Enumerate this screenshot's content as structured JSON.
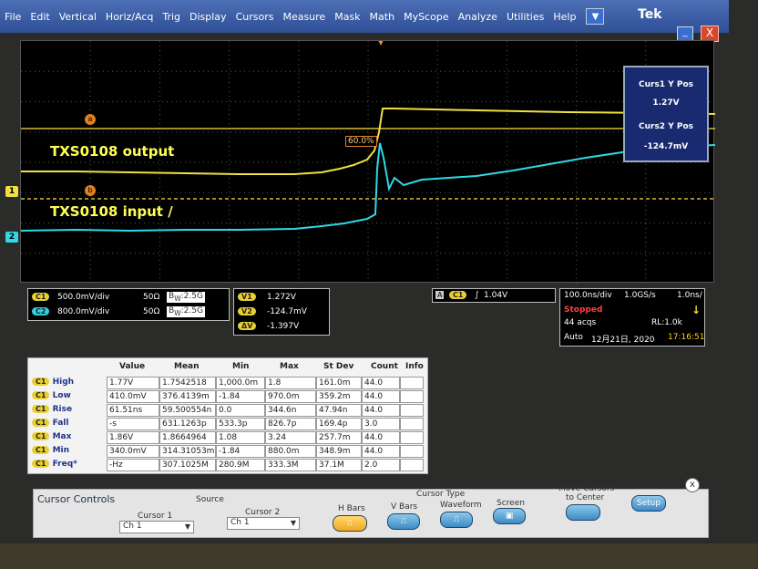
{
  "menu": [
    "File",
    "Edit",
    "Vertical",
    "Horiz/Acq",
    "Trig",
    "Display",
    "Cursors",
    "Measure",
    "Mask",
    "Math",
    "MyScope",
    "Analyze",
    "Utilities",
    "Help"
  ],
  "brand": "Tek",
  "window": {
    "minimize": "_",
    "close": "X",
    "dropdown": "▼"
  },
  "annotations": {
    "output": "TXS0108 output",
    "input": "TXS0108 input /"
  },
  "cursor_markers": {
    "a": "a",
    "b": "b",
    "percent": "60.0%"
  },
  "channel_markers": {
    "ch1": "1",
    "ch2": "2"
  },
  "cursor_readout": {
    "curs1_label": "Curs1 Y Pos",
    "curs1_value": "1.27V",
    "curs2_label": "Curs2 Y Pos",
    "curs2_value": "-124.7mV"
  },
  "channels": [
    {
      "chip": "C1",
      "scale": "500.0mV/div",
      "imp": "50Ω",
      "bw_prefix": "B",
      "bw_sub": "W",
      "bw": ":2.5G"
    },
    {
      "chip": "C2",
      "scale": "800.0mV/div",
      "imp": "50Ω",
      "bw_prefix": "B",
      "bw_sub": "W",
      "bw": ":2.5G"
    }
  ],
  "cursor_values": {
    "v1_label": "V1",
    "v1": "1.272V",
    "v2_label": "V2",
    "v2": "-124.7mV",
    "dv_label": "ΔV",
    "dv": "-1.397V"
  },
  "trigger": {
    "chip_a": "A",
    "chip_c": "C1",
    "slope": "∫",
    "level": "1.04V"
  },
  "acq": {
    "timebase": "100.0ns/div",
    "rate": "1.0GS/s",
    "res": "1.0ns/",
    "state": "Stopped",
    "acqs": "44 acqs",
    "rl": "RL:1.0k",
    "mode": "Auto",
    "date": "12月21日, 2020",
    "time": "17:16:51",
    "arrow": "↓"
  },
  "measurements": {
    "headers": [
      "Value",
      "Mean",
      "Min",
      "Max",
      "St Dev",
      "Count",
      "Info"
    ],
    "rows": [
      {
        "chip": "C1",
        "name": "High",
        "cells": [
          "1.77V",
          "1.7542518",
          "1,000.0m",
          "1.8",
          "161.0m",
          "44.0"
        ]
      },
      {
        "chip": "C1",
        "name": "Low",
        "cells": [
          "410.0mV",
          "376.4139m",
          "-1.84",
          "970.0m",
          "359.2m",
          "44.0"
        ]
      },
      {
        "chip": "C1",
        "name": "Rise",
        "cells": [
          "61.51ns",
          "59.500554n",
          "0.0",
          "344.6n",
          "47.94n",
          "44.0"
        ]
      },
      {
        "chip": "C1",
        "name": "Fall",
        "cells": [
          "-s",
          "631.1263p",
          "533.3p",
          "826.7p",
          "169.4p",
          "3.0"
        ]
      },
      {
        "chip": "C1",
        "name": "Max",
        "cells": [
          "1.86V",
          "1.8664964",
          "1.08",
          "3.24",
          "257.7m",
          "44.0"
        ]
      },
      {
        "chip": "C1",
        "name": "Min",
        "cells": [
          "340.0mV",
          "314.31053m",
          "-1.84",
          "880.0m",
          "348.9m",
          "44.0"
        ]
      },
      {
        "chip": "C1",
        "name": "Freq*",
        "cells": [
          "-Hz",
          "307.1025M",
          "280.9M",
          "333.3M",
          "37.1M",
          "2.0"
        ]
      }
    ]
  },
  "controls": {
    "title": "Cursor Controls",
    "source_label": "Source",
    "cursor1_label": "Cursor 1",
    "cursor1_value": "Ch 1",
    "cursor2_label": "Cursor 2",
    "cursor2_value": "Ch 1",
    "cursor_type_label": "Cursor Type",
    "hbars": "H Bars",
    "vbars": "V Bars",
    "waveform": "Waveform",
    "screen": "Screen",
    "move_cursors": "Move Cursors",
    "to_center": "to Center",
    "setup": "Setup",
    "close": "x"
  },
  "colors": {
    "ch1": "#f0e040",
    "ch2": "#30d8e8",
    "cursor": "#ffe040",
    "menu": "#3a5aa8"
  }
}
